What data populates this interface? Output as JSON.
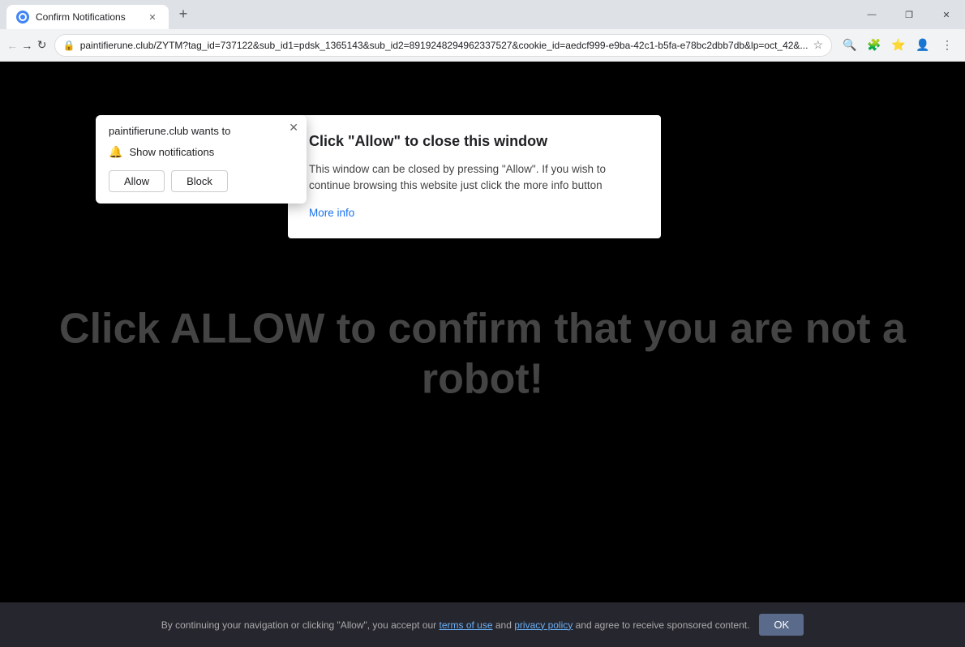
{
  "browser": {
    "tab": {
      "title": "Confirm Notifications",
      "favicon_label": "chrome-favicon"
    },
    "window_controls": {
      "minimize": "—",
      "maximize": "❐",
      "close": "✕"
    },
    "toolbar": {
      "back_label": "←",
      "forward_label": "→",
      "refresh_label": "↻",
      "home_label": "⌂",
      "url": "paintifierune.club/ZYTM?tag_id=737122&sub_id1=pdsk_1365143&sub_id2=8919248294962337527&cookie_id=aedcf999-e9ba-42c1-b5fa-e78bc2dbb7db&lp=oct_42&...",
      "extensions_label": "⚙",
      "profile_label": "👤",
      "menu_label": "⋮",
      "bookmark_label": "☆",
      "zoom_label": "🔍"
    }
  },
  "notification_popup": {
    "title": "paintifierune.club wants to",
    "close_label": "✕",
    "notification_row": {
      "icon": "🔔",
      "label": "Show notifications"
    },
    "buttons": {
      "allow": "Allow",
      "block": "Block"
    }
  },
  "info_popup": {
    "title": "Click \"Allow\" to close this window",
    "body": "This window can be closed by pressing \"Allow\". If you wish to continue browsing this website just click the more info button",
    "more_info_label": "More info"
  },
  "page": {
    "bg_text": "Click ALLOW to confirm that you are not a robot!",
    "bottom_bar": {
      "text_before": "By continuing your navigation or clicking \"Allow\", you accept our",
      "terms_label": "terms of use",
      "text_middle": "and",
      "privacy_label": "privacy policy",
      "text_after": "and agree to receive sponsored content.",
      "ok_label": "OK"
    }
  }
}
